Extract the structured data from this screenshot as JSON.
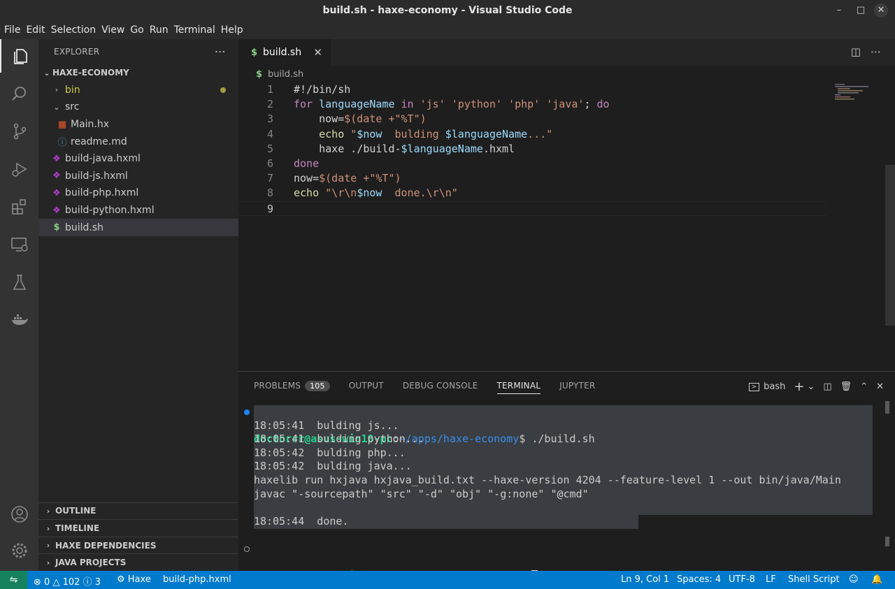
{
  "window": {
    "title": "build.sh - haxe-economy - Visual Studio Code"
  },
  "menu": [
    "File",
    "Edit",
    "Selection",
    "View",
    "Go",
    "Run",
    "Terminal",
    "Help"
  ],
  "activity_icons": [
    "files-icon",
    "search-icon",
    "source-control-icon",
    "run-debug-icon",
    "extensions-icon",
    "remote-explorer-icon",
    "testing-icon",
    "docker-icon",
    "account-icon",
    "settings-gear-icon"
  ],
  "sidebar": {
    "title": "EXPLORER",
    "root": "HAXE-ECONOMY",
    "items": [
      {
        "label": "bin",
        "type": "folder",
        "color": "#cbcb41"
      },
      {
        "label": "src",
        "type": "folder",
        "color": "#cccccc"
      },
      {
        "label": "Main.hx",
        "type": "haxe",
        "color": "#cccccc"
      },
      {
        "label": "readme.md",
        "type": "info",
        "color": "#cccccc"
      },
      {
        "label": "build-java.hxml",
        "type": "hxml",
        "color": "#cccccc"
      },
      {
        "label": "build-js.hxml",
        "type": "hxml",
        "color": "#cccccc"
      },
      {
        "label": "build-php.hxml",
        "type": "hxml",
        "color": "#cccccc"
      },
      {
        "label": "build-python.hxml",
        "type": "hxml",
        "color": "#cccccc"
      },
      {
        "label": "build.sh",
        "type": "shell",
        "color": "#cccccc"
      }
    ],
    "sections": [
      "OUTLINE",
      "TIMELINE",
      "HAXE DEPENDENCIES",
      "JAVA PROJECTS"
    ]
  },
  "editor": {
    "tab_label": "build.sh",
    "breadcrumb": "build.sh",
    "line_numbers": [
      "1",
      "2",
      "3",
      "4",
      "5",
      "6",
      "7",
      "8",
      "9"
    ],
    "lines": [
      [
        [
          "c",
          "#!/bin/sh"
        ]
      ],
      [
        [
          "k",
          "for "
        ],
        [
          "v",
          "languageName"
        ],
        [
          "k",
          " in "
        ],
        [
          "s",
          "'js' 'python' 'php' 'java'"
        ],
        [
          "p",
          "; "
        ],
        [
          "k",
          "do"
        ]
      ],
      [
        [
          "p",
          "    now="
        ],
        [
          "s",
          "$(date +\"%T\")"
        ]
      ],
      [
        [
          "f",
          "    echo "
        ],
        [
          "s",
          "\""
        ],
        [
          "v",
          "$now"
        ],
        [
          "s",
          "  bulding "
        ],
        [
          "v",
          "$languageName"
        ],
        [
          "s",
          "...\""
        ]
      ],
      [
        [
          "p",
          "    haxe ./build-"
        ],
        [
          "v",
          "$languageName"
        ],
        [
          "p",
          ".hxml"
        ]
      ],
      [
        [
          "k",
          "done"
        ]
      ],
      [
        [
          "p",
          "now="
        ],
        [
          "s",
          "$(date +\"%T\")"
        ]
      ],
      [
        [
          "f",
          "echo "
        ],
        [
          "s",
          "\"\\r\\n"
        ],
        [
          "v",
          "$now"
        ],
        [
          "s",
          "  done.\\r\\n\""
        ]
      ],
      []
    ]
  },
  "panel": {
    "tabs": [
      "PROBLEMS",
      "OUTPUT",
      "DEBUG CONSOLE",
      "TERMINAL",
      "JUPYTER"
    ],
    "problems_count": "105",
    "shell_label": "bash",
    "prompt_user": "doctorrr@asus-win10-pc",
    "prompt_path": "~/apps/haxe-economy",
    "prompt_suffix": "$ ",
    "command": "./build.sh",
    "output": [
      "18:05:41  bulding js...",
      "18:05:41  bulding python...",
      "18:05:42  bulding php...",
      "18:05:42  bulding java...",
      "haxelib run hxjava hxjava_build.txt --haxe-version 4204 --feature-level 1 --out bin/java/Main",
      "javac \"-sourcepath\" \"src\" \"-d\" \"obj\" \"-g:none\" \"@cmd\"",
      "",
      "18:05:44  done."
    ]
  },
  "status": {
    "errors": "0",
    "warnings": "102",
    "infos": "3",
    "haxe_label": "Haxe",
    "hxml_file": "build-php.hxml",
    "position": "Ln 9, Col 1",
    "spaces": "Spaces: 4",
    "encoding": "UTF-8",
    "eol": "LF",
    "language": "Shell Script"
  }
}
